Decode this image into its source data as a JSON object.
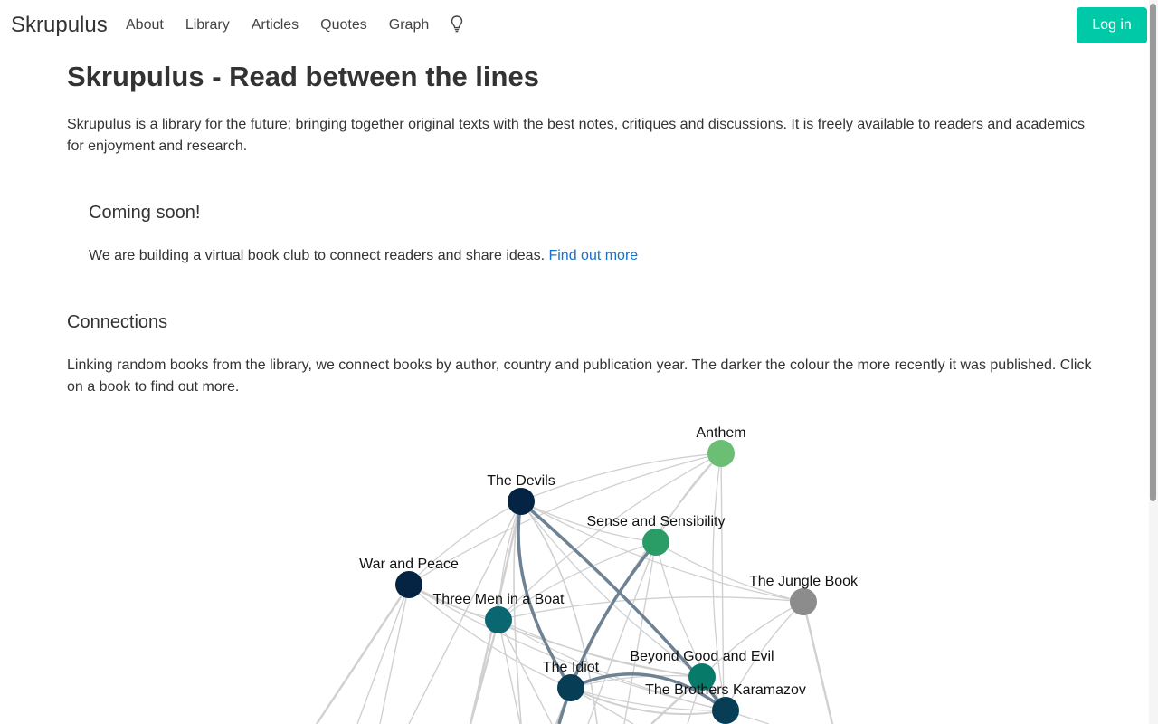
{
  "brand": "Skrupulus",
  "nav": {
    "about": "About",
    "library": "Library",
    "articles": "Articles",
    "quotes": "Quotes",
    "graph": "Graph",
    "theme_icon": "lightbulb-icon"
  },
  "login_label": "Log in",
  "page": {
    "title": "Skrupulus - Read between the lines",
    "intro": "Skrupulus is a library for the future; bringing together original texts with the best notes, critiques and discussions. It is freely available to readers and academics for enjoyment and research."
  },
  "coming_soon": {
    "title": "Coming soon!",
    "text": "We are building a virtual book club to connect readers and share ideas.",
    "link": "Find out more"
  },
  "connections": {
    "title": "Connections",
    "text": "Linking random books from the library, we connect books by author, country and publication year. The darker the colour the more recently it was published. Click on a book to find out more."
  },
  "graph": {
    "nodes": [
      {
        "label": "Anthem",
        "color": "#6abf74"
      },
      {
        "label": "The Devils",
        "color": "#052443"
      },
      {
        "label": "Sense and Sensibility",
        "color": "#2a9d66"
      },
      {
        "label": "War and Peace",
        "color": "#052443"
      },
      {
        "label": "The Jungle Book",
        "color": "#8c8c8c"
      },
      {
        "label": "Three Men in a Boat",
        "color": "#0a6670"
      },
      {
        "label": "Beyond Good and Evil",
        "color": "#077a6a"
      },
      {
        "label": "The Idiot",
        "color": "#073e56"
      },
      {
        "label": "The Brothers Karamazov",
        "color": "#073e56"
      }
    ],
    "colors": {
      "light_edge": "#d0d0d0",
      "strong_edge": "#6e8294"
    }
  }
}
